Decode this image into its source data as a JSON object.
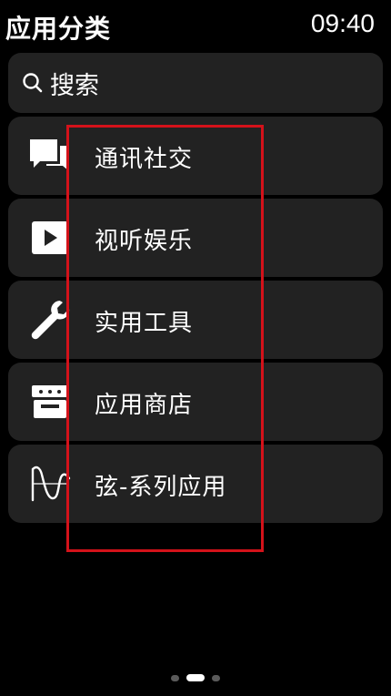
{
  "header": {
    "title": "应用分类",
    "time": "09:40"
  },
  "search": {
    "label": "搜索",
    "icon": "search-icon"
  },
  "categories": [
    {
      "label": "通讯社交",
      "icon": "chat-icon"
    },
    {
      "label": "视听娱乐",
      "icon": "play-icon"
    },
    {
      "label": "实用工具",
      "icon": "wrench-icon"
    },
    {
      "label": "应用商店",
      "icon": "store-icon"
    },
    {
      "label": "弦-系列应用",
      "icon": "waveform-icon"
    }
  ],
  "highlight_color": "#d4121a",
  "pager": {
    "page_count": 3,
    "active_index": 1
  }
}
